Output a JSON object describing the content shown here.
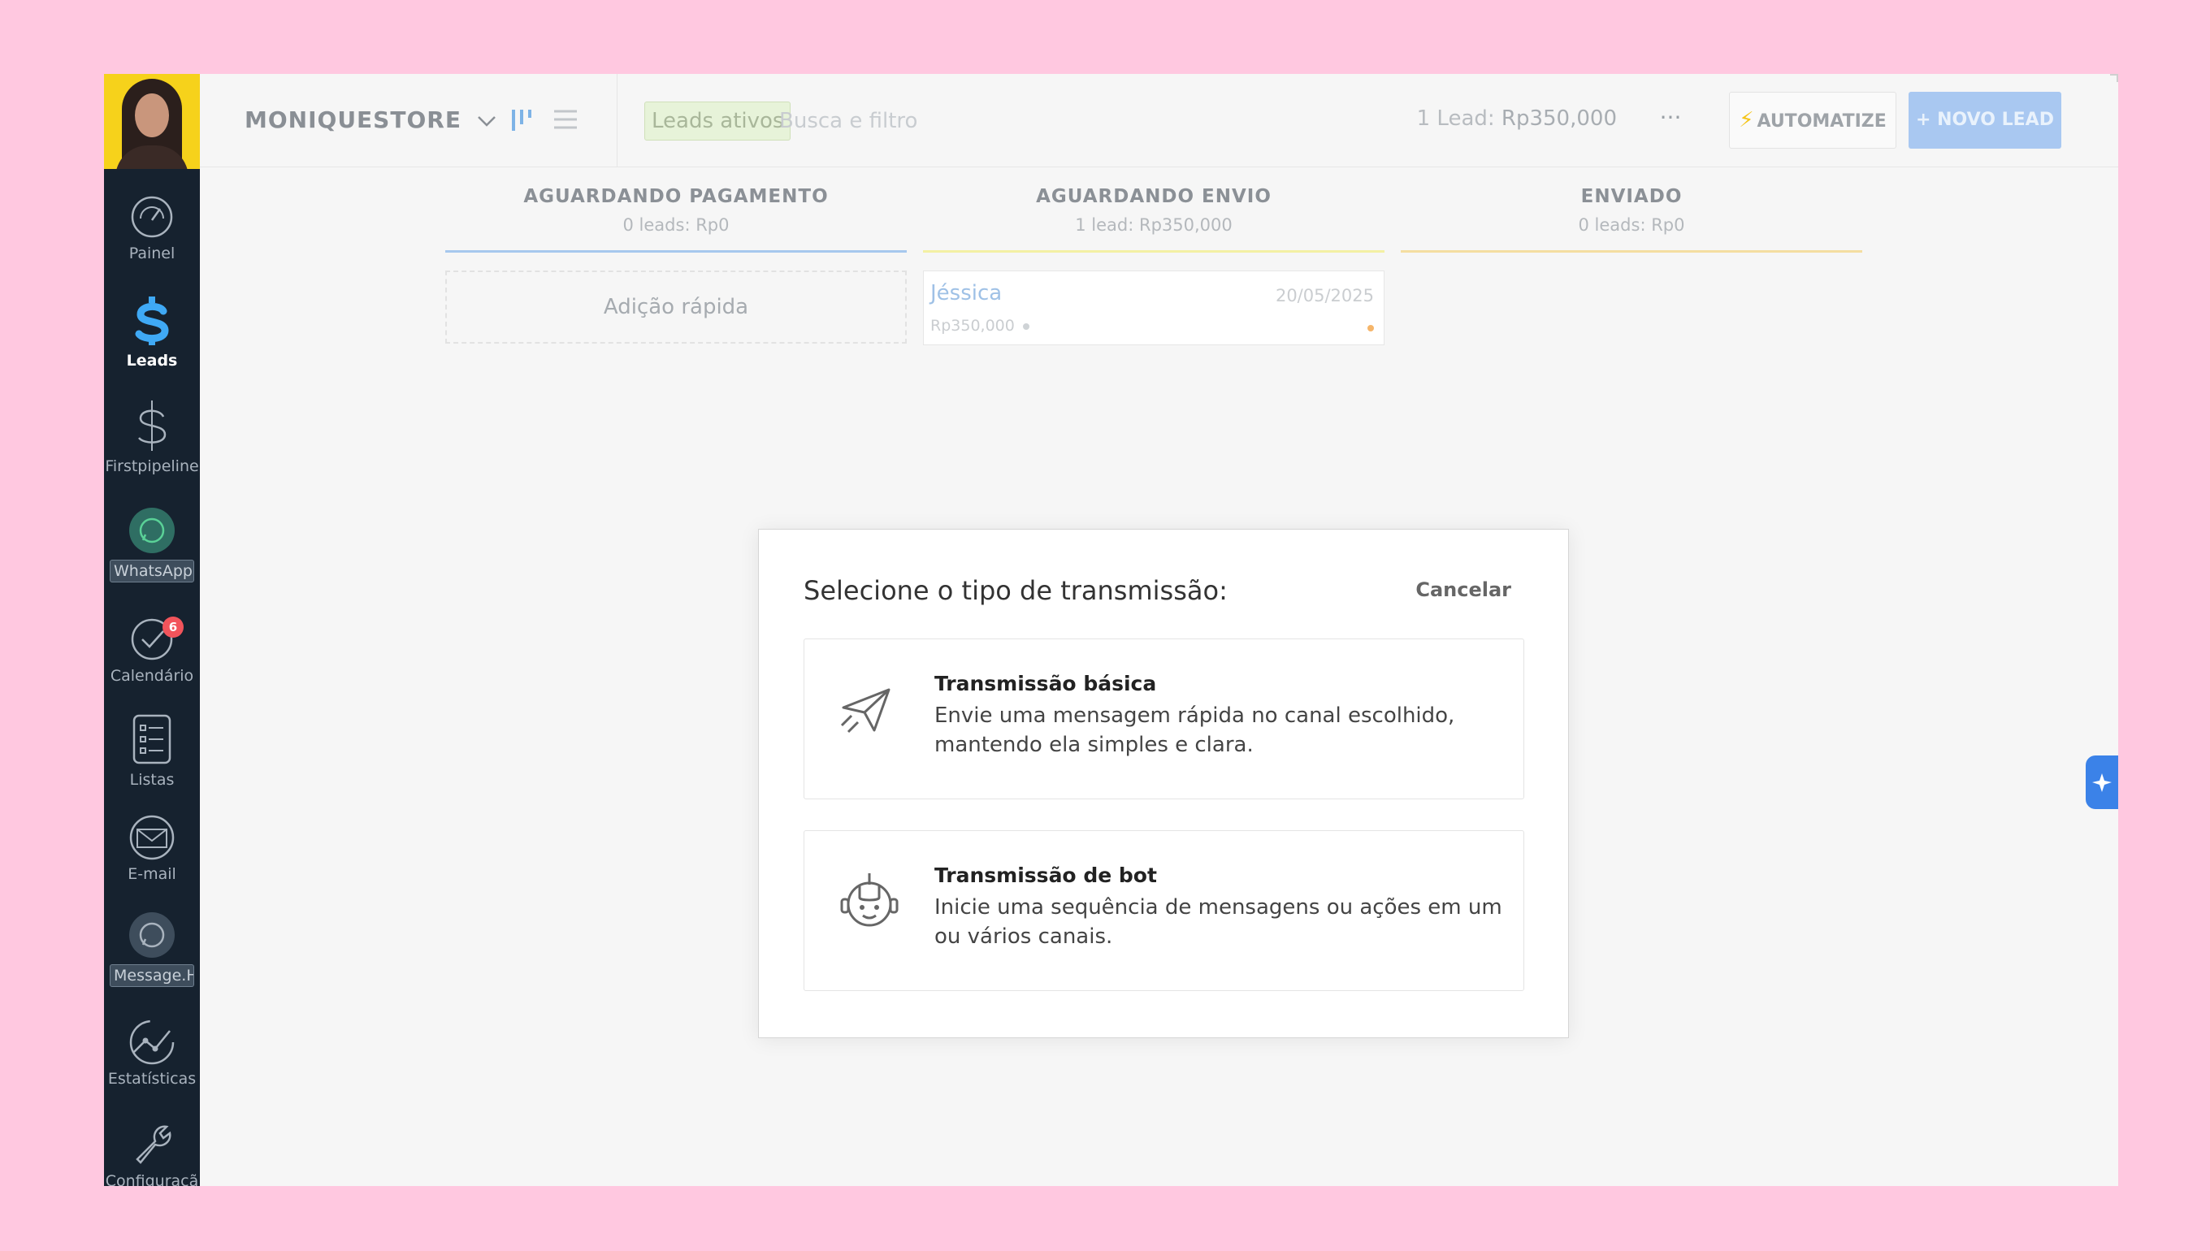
{
  "sidebar": {
    "items": [
      {
        "label": "Painel",
        "icon": "speedometer-icon"
      },
      {
        "label": "Leads",
        "icon": "leads-dollar-icon"
      },
      {
        "label": "Firstpipeline",
        "icon": "dollar-icon"
      },
      {
        "label": "WhatsApp",
        "icon": "whatsapp-icon"
      },
      {
        "label": "Calendário",
        "icon": "check-circle-icon",
        "badge": "6"
      },
      {
        "label": "Listas",
        "icon": "list-icon"
      },
      {
        "label": "E-mail",
        "icon": "mail-icon"
      },
      {
        "label": "Message.H",
        "icon": "whatsapp-icon"
      },
      {
        "label": "Estatísticas",
        "icon": "stats-icon"
      },
      {
        "label": "Configuraçã",
        "icon": "wrench-icon"
      }
    ]
  },
  "topbar": {
    "pipeline_name": "MONIQUESTORE",
    "filter_tag": "Leads ativos",
    "search_placeholder": "Busca e filtro",
    "lead_count": "1 Lead:",
    "lead_amount": "Rp350,000",
    "more": "···",
    "automate_label": "AUTOMATIZE",
    "new_lead_label": "+ NOVO LEAD"
  },
  "columns": [
    {
      "title": "AGUARDANDO PAGAMENTO",
      "summary": "0 leads: Rp0",
      "color": "#a7c8ee"
    },
    {
      "title": "AGUARDANDO ENVIO",
      "summary": "1 lead: Rp350,000",
      "color": "#f3f0a4"
    },
    {
      "title": "ENVIADO",
      "summary": "0 leads: Rp0",
      "color": "#f4dea1"
    }
  ],
  "board": {
    "quick_add": "Adição rápida",
    "lead_card": {
      "name": "Jéssica",
      "date": "20/05/2025",
      "price": "Rp350,000"
    }
  },
  "modal": {
    "title": "Selecione o tipo de transmissão:",
    "cancel": "Cancelar",
    "options": [
      {
        "title": "Transmissão básica",
        "description": "Envie uma mensagem rápida no canal escolhido, mantendo ela simples e clara.",
        "icon": "paper-plane-icon"
      },
      {
        "title": "Transmissão de bot",
        "description": "Inicie uma sequência de mensagens ou ações em um ou vários canais.",
        "icon": "robot-icon"
      }
    ]
  }
}
